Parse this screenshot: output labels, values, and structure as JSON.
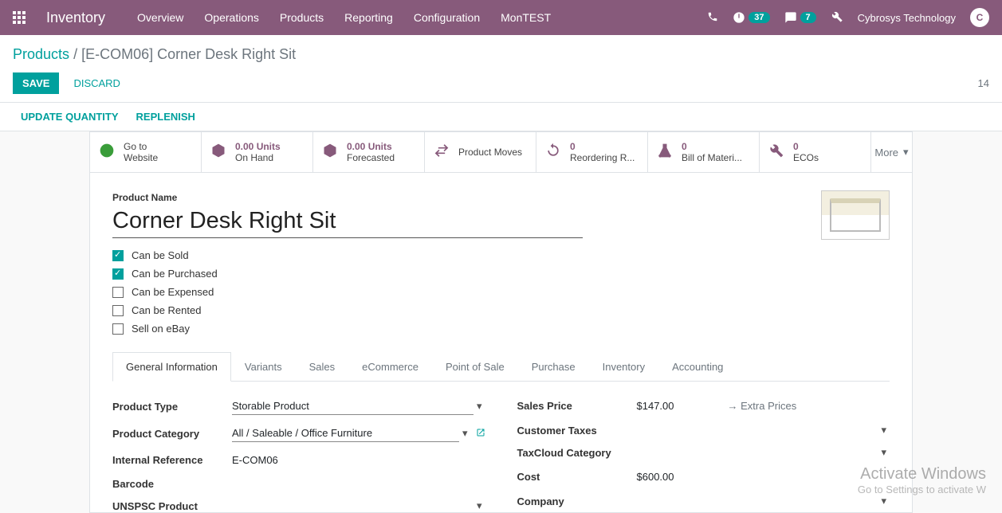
{
  "topbar": {
    "brand": "Inventory",
    "nav": [
      "Overview",
      "Operations",
      "Products",
      "Reporting",
      "Configuration",
      "MonTEST"
    ],
    "activity_badge": "37",
    "chat_badge": "7",
    "user": "Cybrosys Technology",
    "avatar_letter": "C"
  },
  "breadcrumb": {
    "root": "Products",
    "current": "[E-COM06] Corner Desk Right Sit"
  },
  "actions": {
    "save": "SAVE",
    "discard": "DISCARD",
    "pager": "14",
    "update_qty": "UPDATE QUANTITY",
    "replenish": "REPLENISH"
  },
  "stats": {
    "website": {
      "l1": "Go to",
      "l2": "Website"
    },
    "onhand": {
      "num": "0.00 Units",
      "l2": "On Hand"
    },
    "forecast": {
      "num": "0.00 Units",
      "l2": "Forecasted"
    },
    "moves": {
      "l1": "Product Moves"
    },
    "reorder": {
      "num": "0",
      "l2": "Reordering R..."
    },
    "bom": {
      "num": "0",
      "l2": "Bill of Materi..."
    },
    "ecos": {
      "num": "0",
      "l2": "ECOs"
    },
    "more": "More"
  },
  "form": {
    "name_label": "Product Name",
    "name_value": "Corner Desk Right Sit",
    "checks": {
      "sold": {
        "label": "Can be Sold",
        "checked": true
      },
      "purchased": {
        "label": "Can be Purchased",
        "checked": true
      },
      "expensed": {
        "label": "Can be Expensed",
        "checked": false
      },
      "rented": {
        "label": "Can be Rented",
        "checked": false
      },
      "ebay": {
        "label": "Sell on eBay",
        "checked": false
      }
    }
  },
  "tabs": [
    "General Information",
    "Variants",
    "Sales",
    "eCommerce",
    "Point of Sale",
    "Purchase",
    "Inventory",
    "Accounting"
  ],
  "fields": {
    "left": {
      "product_type": {
        "label": "Product Type",
        "value": "Storable Product"
      },
      "category": {
        "label": "Product Category",
        "value": "All / Saleable / Office Furniture"
      },
      "internal_ref": {
        "label": "Internal Reference",
        "value": "E-COM06"
      },
      "barcode": {
        "label": "Barcode",
        "value": ""
      },
      "unspsc": {
        "label": "UNSPSC Product",
        "value": ""
      }
    },
    "right": {
      "sales_price": {
        "label": "Sales Price",
        "value": "$147.00",
        "extra": "Extra Prices"
      },
      "customer_taxes": {
        "label": "Customer Taxes",
        "value": ""
      },
      "taxcloud": {
        "label": "TaxCloud Category",
        "value": ""
      },
      "cost": {
        "label": "Cost",
        "value": "$600.00"
      },
      "company": {
        "label": "Company",
        "value": ""
      }
    }
  },
  "watermark": {
    "title": "Activate Windows",
    "sub": "Go to Settings to activate W"
  }
}
